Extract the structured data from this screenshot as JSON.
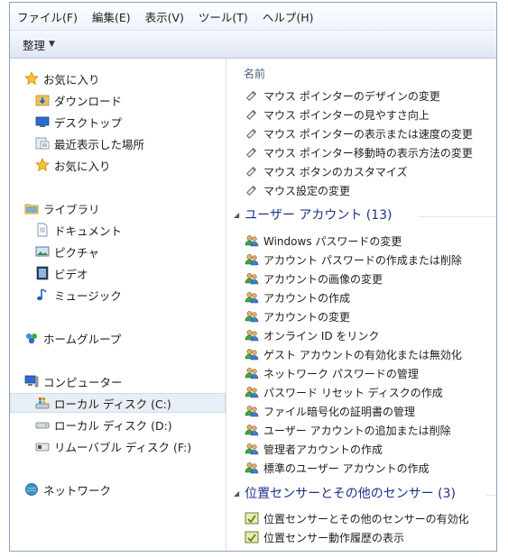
{
  "menubar": [
    "ファイル(F)",
    "編集(E)",
    "表示(V)",
    "ツール(T)",
    "ヘルプ(H)"
  ],
  "toolbar": {
    "organize_label": "整理"
  },
  "nav": {
    "favorites": {
      "label": "お気に入り",
      "items": [
        "ダウンロード",
        "デスクトップ",
        "最近表示した場所",
        "お気に入り"
      ]
    },
    "libraries": {
      "label": "ライブラリ",
      "items": [
        "ドキュメント",
        "ピクチャ",
        "ビデオ",
        "ミュージック"
      ]
    },
    "homegroup": {
      "label": "ホームグループ"
    },
    "computer": {
      "label": "コンピューター",
      "items": [
        "ローカル ディスク (C:)",
        "ローカル ディスク (D:)",
        "リムーバブル ディスク (F:)"
      ]
    },
    "network": {
      "label": "ネットワーク"
    }
  },
  "content": {
    "column_header": "名前",
    "mouse_items": [
      "マウス ポインターのデザインの変更",
      "マウス ポインターの見やすさ向上",
      "マウス ポインターの表示または速度の変更",
      "マウス ポインター移動時の表示方法の変更",
      "マウス ボタンのカスタマイズ",
      "マウス設定の変更"
    ],
    "groups": [
      {
        "title": "ユーザー アカウント (13)",
        "items": [
          "Windows パスワードの変更",
          "アカウント パスワードの作成または削除",
          "アカウントの画像の変更",
          "アカウントの作成",
          "アカウントの変更",
          "オンライン ID をリンク",
          "ゲスト アカウントの有効化または無効化",
          "ネットワーク パスワードの管理",
          "パスワード リセット ディスクの作成",
          "ファイル暗号化の証明書の管理",
          "ユーザー アカウントの追加または削除",
          "管理者アカウントの作成",
          "標準のユーザー アカウントの作成"
        ]
      },
      {
        "title": "位置センサーとその他のセンサー (3)",
        "items": [
          "位置センサーとその他のセンサーの有効化",
          "位置センサー動作履歴の表示"
        ]
      }
    ]
  },
  "colors": {
    "group_title": "#1e3287",
    "header_text": "#4d6185",
    "border": "#8aa2c1"
  }
}
